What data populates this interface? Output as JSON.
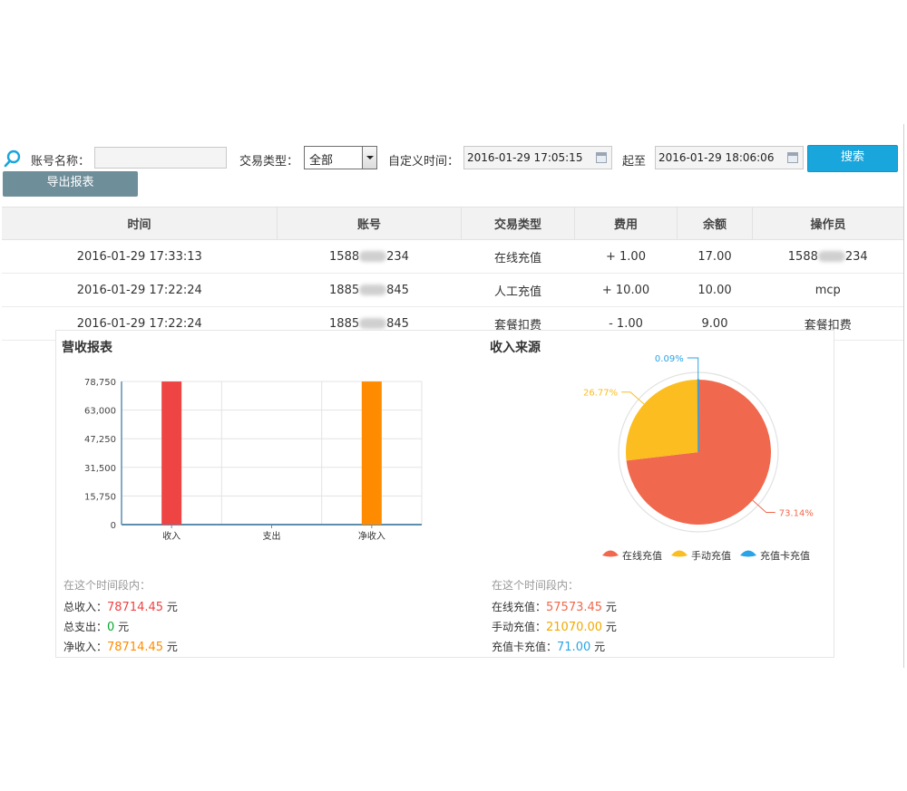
{
  "filters": {
    "account_label": "账号名称：",
    "account_value": "",
    "type_label": "交易类型：",
    "type_selected": "全部",
    "custom_time_label": "自定义时间：",
    "start_time": "2016-01-29 17:05:15",
    "to_label": "起至",
    "end_time": "2016-01-29 18:06:06",
    "search_button": "搜索",
    "export_button": "导出报表"
  },
  "table": {
    "headers": [
      "时间",
      "账号",
      "交易类型",
      "费用",
      "余额",
      "操作员"
    ],
    "rows": [
      {
        "time": "2016-01-29 17:33:13",
        "account_prefix": "1588",
        "account_suffix": "234",
        "type": "在线充值",
        "fee": "+ 1.00",
        "balance": "17.00",
        "operator_prefix": "1588",
        "operator_suffix": "234",
        "operator": ""
      },
      {
        "time": "2016-01-29 17:22:24",
        "account_prefix": "1885",
        "account_suffix": "845",
        "type": "人工充值",
        "fee": "+ 10.00",
        "balance": "10.00",
        "operator_prefix": "",
        "operator_suffix": "",
        "operator": "mcp"
      },
      {
        "time": "2016-01-29 17:22:24",
        "account_prefix": "1885",
        "account_suffix": "845",
        "type": "套餐扣费",
        "fee": "- 1.00",
        "balance": "9.00",
        "operator_prefix": "",
        "operator_suffix": "",
        "operator": "套餐扣费"
      }
    ]
  },
  "revenue_panel": {
    "title": "营收报表",
    "period_label": "在这个时间段内：",
    "total_income_label": "总收入：",
    "total_income": "78714.45",
    "total_expense_label": "总支出：",
    "total_expense": "0",
    "net_income_label": "净收入：",
    "net_income": "78714.45",
    "unit": "元"
  },
  "source_panel": {
    "title": "收入来源",
    "period_label": "在这个时间段内：",
    "online_label": "在线充值：",
    "online_value": "57573.45",
    "manual_label": "手动充值：",
    "manual_value": "21070.00",
    "card_label": "充值卡充值：",
    "card_value": "71.00",
    "unit": "元"
  },
  "colors": {
    "income": "#ef4444",
    "expense": "#0aa82e",
    "net": "#ff8c00",
    "online": "#f0684d",
    "manual": "#fbbd1f",
    "card": "#2aa4e6",
    "search_button": "#18a6dc",
    "export_button": "#6e8e9a"
  },
  "chart_data": [
    {
      "type": "bar",
      "categories": [
        "收入",
        "支出",
        "净收入"
      ],
      "values": [
        78714.45,
        0,
        78714.45
      ],
      "colors": [
        "#ef4444",
        "#0aa82e",
        "#ff8c00"
      ],
      "ylim": [
        0,
        78750
      ],
      "yticks": [
        0,
        15750,
        31500,
        47250,
        63000,
        78750
      ],
      "ytick_labels": [
        "0",
        "15,750",
        "31,500",
        "47,250",
        "63,000",
        "78,750"
      ],
      "grid": true
    },
    {
      "type": "pie",
      "slices": [
        {
          "name": "在线充值",
          "value": 57573.45,
          "label": "73.14%",
          "color": "#f0684d"
        },
        {
          "name": "手动充值",
          "value": 21070.0,
          "label": "26.77%",
          "color": "#fbbd1f"
        },
        {
          "name": "充值卡充值",
          "value": 71.0,
          "label": "0.09%",
          "color": "#2aa4e6"
        }
      ],
      "legend_position": "bottom"
    }
  ]
}
